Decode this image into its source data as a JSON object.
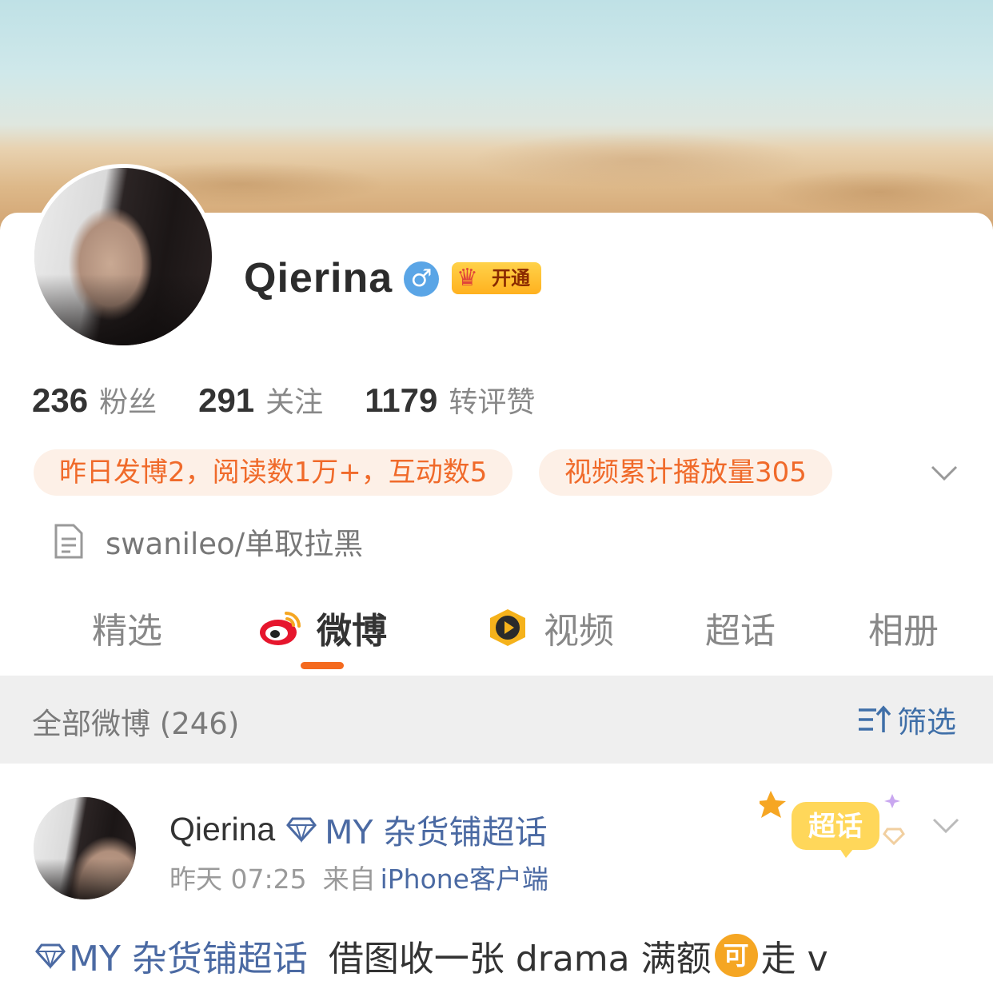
{
  "profile": {
    "name": "Qierina",
    "vip_label": "开通",
    "bio": "swanileo/单取拉黑"
  },
  "stats": [
    {
      "value": "236",
      "label": "粉丝"
    },
    {
      "value": "291",
      "label": "关注"
    },
    {
      "value": "1179",
      "label": "转评赞"
    }
  ],
  "pills": {
    "yesterday": "昨日发博2，阅读数1万+，互动数5",
    "video": "视频累计播放量305"
  },
  "tabs": [
    {
      "label": "精选",
      "active": false
    },
    {
      "label": "微博",
      "active": true
    },
    {
      "label": "视频",
      "active": false
    },
    {
      "label": "超话",
      "active": false
    },
    {
      "label": "相册",
      "active": false
    }
  ],
  "filter": {
    "all_label": "全部微博 (246)",
    "filter_label": "筛选"
  },
  "post": {
    "author": "Qierina",
    "topic": "MY 杂货铺超话",
    "time": "昨天 07:25",
    "from_prefix": "来自",
    "source": "iPhone客户端",
    "badge_text": "超话",
    "body_topic": "MY 杂货铺超话",
    "body_text_1": "借图收一张 drama 满额",
    "body_badge": "可",
    "body_text_2": "走 v"
  },
  "colors": {
    "accent": "#f46a1f",
    "link": "#4b6aa3",
    "pill_bg": "#fdf0e7",
    "pill_text": "#f06a2a"
  }
}
